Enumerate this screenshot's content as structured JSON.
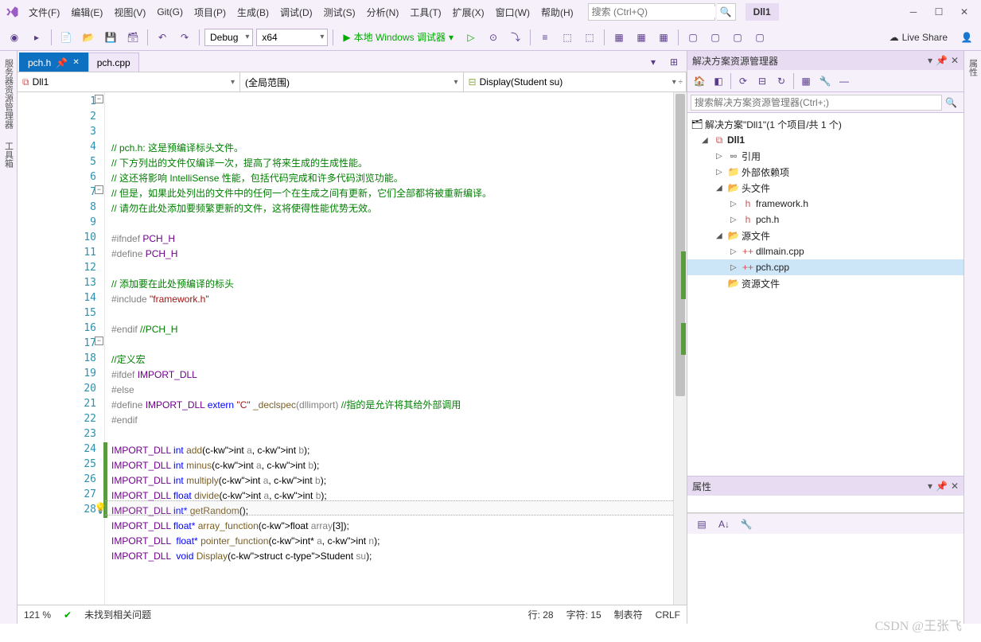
{
  "menu": {
    "file": "文件(F)",
    "edit": "编辑(E)",
    "view": "视图(V)",
    "git": "Git(G)",
    "project": "项目(P)",
    "build": "生成(B)",
    "debug": "调试(D)",
    "test": "测试(S)",
    "analyze": "分析(N)",
    "tools": "工具(T)",
    "extensions": "扩展(X)",
    "window": "窗口(W)",
    "help": "帮助(H)"
  },
  "search_placeholder": "搜索 (Ctrl+Q)",
  "solution_badge": "Dll1",
  "toolbar": {
    "config": "Debug",
    "platform": "x64",
    "debugger": "本地 Windows 调试器",
    "live_share": "Live Share"
  },
  "left_tabs": {
    "server": "服务器资源管理器",
    "toolbox": "工具箱"
  },
  "right_tab": "属性",
  "tabs": [
    {
      "label": "pch.h",
      "active": true
    },
    {
      "label": "pch.cpp",
      "active": false
    }
  ],
  "nav": {
    "scope1": "Dll1",
    "scope2": "(全局范围)",
    "scope3": "Display(Student su)"
  },
  "code_lines": [
    {
      "n": 1,
      "t": "comment",
      "txt": "// pch.h: 这是预编译标头文件。"
    },
    {
      "n": 2,
      "t": "comment",
      "txt": "// 下方列出的文件仅编译一次，提高了将来生成的生成性能。"
    },
    {
      "n": 3,
      "t": "comment",
      "txt": "// 这还将影响 IntelliSense 性能，包括代码完成和许多代码浏览功能。"
    },
    {
      "n": 4,
      "t": "comment",
      "txt": "// 但是，如果此处列出的文件中的任何一个在生成之间有更新，它们全部都将被重新编译。"
    },
    {
      "n": 5,
      "t": "comment",
      "txt": "// 请勿在此处添加要频繁更新的文件，这将使得性能优势无效。"
    },
    {
      "n": 6,
      "t": "blank",
      "txt": ""
    },
    {
      "n": 7,
      "t": "pp",
      "pre": "#ifndef ",
      "macro": "PCH_H"
    },
    {
      "n": 8,
      "t": "pp",
      "pre": "#define ",
      "macro": "PCH_H"
    },
    {
      "n": 9,
      "t": "blank",
      "txt": ""
    },
    {
      "n": 10,
      "t": "comment",
      "txt": "// 添加要在此处预编译的标头"
    },
    {
      "n": 11,
      "t": "include",
      "pre": "#include ",
      "str": "\"framework.h\""
    },
    {
      "n": 12,
      "t": "blank",
      "txt": ""
    },
    {
      "n": 13,
      "t": "ppend",
      "pre": "#endif ",
      "cmt": "//PCH_H"
    },
    {
      "n": 14,
      "t": "blank",
      "txt": ""
    },
    {
      "n": 15,
      "t": "comment",
      "txt": "//定义宏"
    },
    {
      "n": 16,
      "t": "pp",
      "pre": "#ifdef ",
      "macro": "IMPORT_DLL"
    },
    {
      "n": 17,
      "t": "ppelse",
      "pre": "#else"
    },
    {
      "n": 18,
      "t": "define_line"
    },
    {
      "n": 19,
      "t": "ppend2",
      "pre": "#endif"
    },
    {
      "n": 20,
      "t": "blank",
      "txt": ""
    },
    {
      "n": 21,
      "t": "fn",
      "ret": "int",
      "name": "add",
      "params": "(int a, int b)"
    },
    {
      "n": 22,
      "t": "fn",
      "ret": "int",
      "name": "minus",
      "params": "(int a, int b)"
    },
    {
      "n": 23,
      "t": "fn",
      "ret": "int",
      "name": "multiply",
      "params": "(int a, int b)"
    },
    {
      "n": 24,
      "t": "fn",
      "ret": "float",
      "name": "divide",
      "params": "(int a, int b)"
    },
    {
      "n": 25,
      "t": "fn",
      "ret": "int*",
      "name": "getRandom",
      "params": "()"
    },
    {
      "n": 26,
      "t": "fn",
      "ret": "float*",
      "name": "array_function",
      "params": "(float array[3])"
    },
    {
      "n": 27,
      "t": "fn2",
      "ret": "float*",
      "name": "pointer_function",
      "params": "(int* a, int n)"
    },
    {
      "n": 28,
      "t": "fn3",
      "ret": "void",
      "name": "Display",
      "params": "(struct Student su)"
    }
  ],
  "line18": {
    "pre": "#define ",
    "macro": "IMPORT_DLL",
    "kw": "extern",
    "str": "\"C\"",
    "decl": "_declspec",
    "arg": "(dllimport)",
    "cmt": "//指的是允许将其给外部调用"
  },
  "status": {
    "zoom": "121 %",
    "issues": "未找到相关问题",
    "line": "行: 28",
    "col": "字符: 15",
    "tabs": "制表符",
    "eol": "CRLF"
  },
  "solution": {
    "title": "解决方案资源管理器",
    "search_ph": "搜索解决方案资源管理器(Ctrl+;)",
    "root": "解决方案\"Dll1\"(1 个项目/共 1 个)",
    "project": "Dll1",
    "refs": "引用",
    "ext": "外部依赖项",
    "headers": "头文件",
    "h1": "framework.h",
    "h2": "pch.h",
    "sources": "源文件",
    "s1": "dllmain.cpp",
    "s2": "pch.cpp",
    "res": "资源文件"
  },
  "props_title": "属性",
  "watermark": "CSDN @王张飞"
}
